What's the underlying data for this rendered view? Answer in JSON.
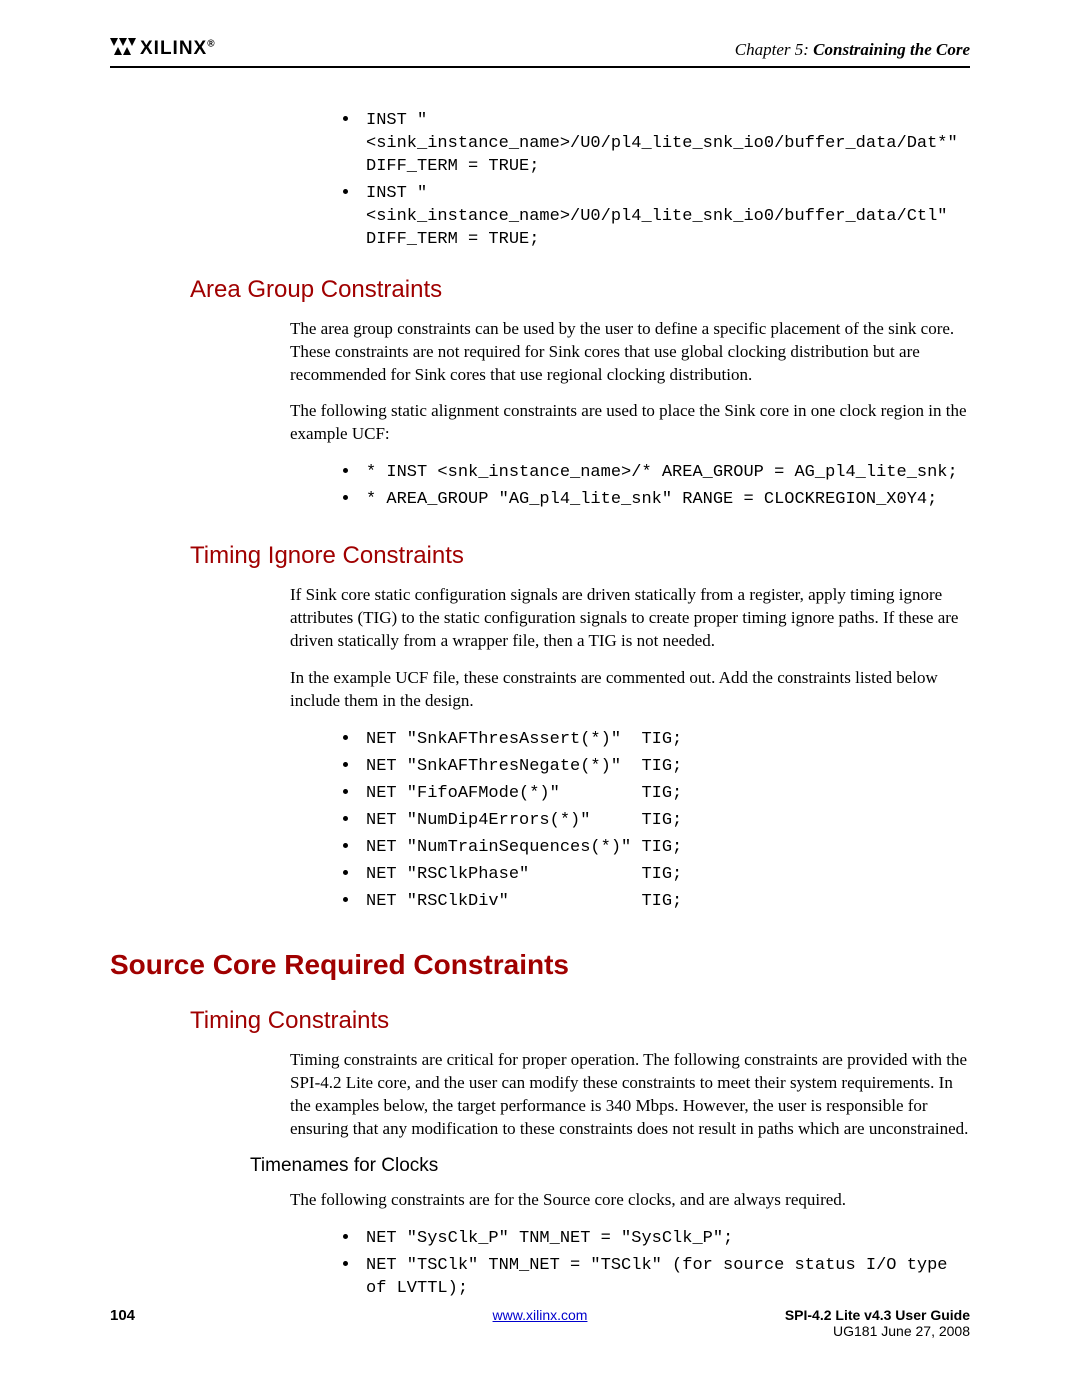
{
  "header": {
    "logo_text": "XILINX",
    "chapter_prefix": "Chapter 5:  ",
    "chapter_title": "Constraining the Core"
  },
  "intro_code": [
    "INST \"<sink_instance_name>/U0/pl4_lite_snk_io0/buffer_data/Dat*\" DIFF_TERM = TRUE;",
    "INST \"<sink_instance_name>/U0/pl4_lite_snk_io0/buffer_data/Ctl\" DIFF_TERM = TRUE;"
  ],
  "area_group": {
    "heading": "Area Group Constraints",
    "p1": "The area group constraints can be used by the user to define a specific placement of the sink core. These constraints are not required for Sink cores that use global clocking distribution but are recommended for Sink cores that use regional clocking distribution.",
    "p2": "The following static alignment constraints are used to place the Sink core in one clock region in the example UCF:",
    "code": [
      "* INST <snk_instance_name>/* AREA_GROUP = AG_pl4_lite_snk;",
      "* AREA_GROUP \"AG_pl4_lite_snk\" RANGE = CLOCKREGION_X0Y4;"
    ]
  },
  "timing_ignore": {
    "heading": "Timing Ignore Constraints",
    "p1": "If Sink core static configuration signals are driven statically from a register, apply timing ignore attributes (TIG) to the static configuration signals to create proper timing ignore paths. If these are driven statically from a wrapper file, then a TIG is not needed.",
    "p2": "In the example UCF file, these constraints are commented out. Add the constraints listed below include them in the design.",
    "code": [
      "NET \"SnkAFThresAssert(*)\"  TIG;",
      "NET \"SnkAFThresNegate(*)\"  TIG;",
      "NET \"FifoAFMode(*)\"        TIG;",
      "NET \"NumDip4Errors(*)\"     TIG;",
      "NET \"NumTrainSequences(*)\" TIG;",
      "NET \"RSClkPhase\"           TIG;",
      "NET \"RSClkDiv\"             TIG;"
    ]
  },
  "source_core": {
    "heading": "Source Core Required Constraints",
    "timing": {
      "heading": "Timing Constraints",
      "p1": "Timing constraints are critical for proper operation. The following constraints are provided with the SPI-4.2 Lite core, and the user can modify these constraints to meet their system requirements. In the examples below, the target performance is 340 Mbps. However, the user is responsible for ensuring that any modification to these constraints does not result in paths which are unconstrained.",
      "timenames_heading": "Timenames for Clocks",
      "p2": "The following constraints are for the Source core clocks, and are always required.",
      "code": [
        "NET \"SysClk_P\" TNM_NET = \"SysClk_P\";",
        "NET \"TSClk\" TNM_NET = \"TSClk\" (for source status I/O type of LVTTL);"
      ]
    }
  },
  "footer": {
    "page": "104",
    "link": "www.xilinx.com",
    "guide": "SPI-4.2 Lite v4.3 User Guide",
    "docid": "UG181 June 27, 2008"
  }
}
